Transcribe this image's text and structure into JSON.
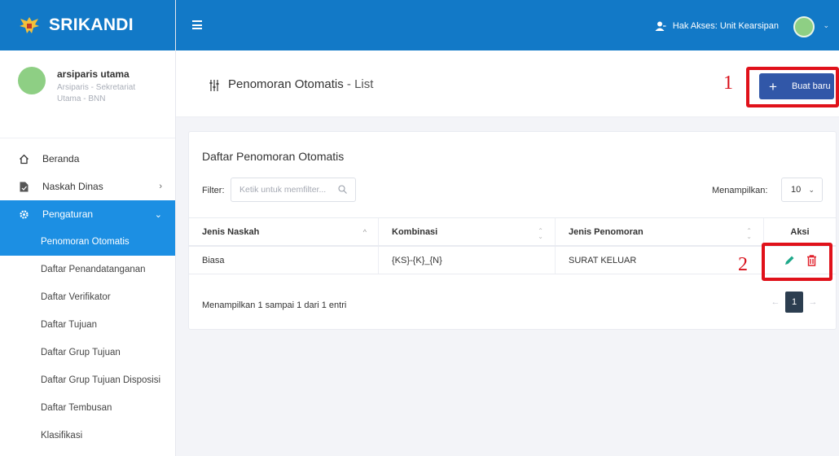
{
  "brand": {
    "name": "SRIKANDI"
  },
  "profile": {
    "name": "arsiparis utama",
    "role": "Arsiparis - Sekretariat Utama - BNN"
  },
  "nav": {
    "beranda": "Beranda",
    "naskah_dinas": "Naskah Dinas",
    "pengaturan": "Pengaturan",
    "sub_items": [
      "Penomoran Otomatis",
      "Daftar Penandatanganan",
      "Daftar Verifikator",
      "Daftar Tujuan",
      "Daftar Grup Tujuan",
      "Daftar Grup Tujuan Disposisi",
      "Daftar Tembusan",
      "Klasifikasi"
    ]
  },
  "topbar": {
    "access_label": "Hak Akses: Unit Kearsipan"
  },
  "header": {
    "title": "Penomoran Otomatis",
    "subtitle": " - List",
    "new_button": "Buat baru"
  },
  "markers": {
    "one": "1",
    "two": "2"
  },
  "card": {
    "title": "Daftar Penomoran Otomatis",
    "filter_label": "Filter:",
    "filter_placeholder": "Ketik untuk memfilter...",
    "show_label": "Menampilkan:",
    "show_value": "10",
    "columns": [
      "Jenis Naskah",
      "Kombinasi",
      "Jenis Penomoran",
      "Aksi"
    ],
    "rows": [
      {
        "jenis_naskah": "Biasa",
        "kombinasi": "{KS}-{K}_{N}",
        "jenis_penomoran": "SURAT KELUAR"
      }
    ],
    "info": "Menampilkan 1 sampai 1 dari 1 entri",
    "pager": {
      "prev": "←",
      "current": "1",
      "next": "→"
    }
  },
  "colors": {
    "primary": "#1279c7",
    "active": "#1c8fe3",
    "button": "#3157a8",
    "annotation": "#e0111a"
  }
}
